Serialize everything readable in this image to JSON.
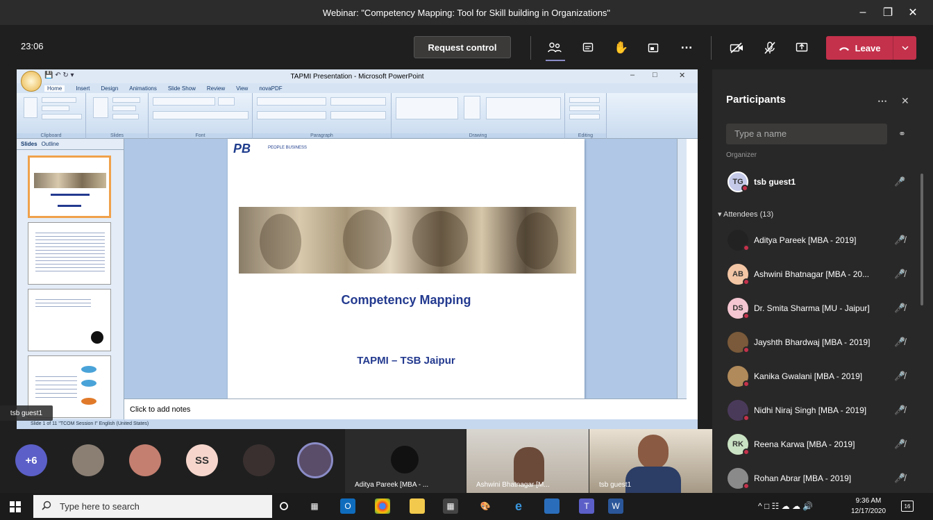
{
  "window": {
    "title": "Webinar: \"Competency Mapping: Tool for Skill building in Organizations\""
  },
  "meeting": {
    "timer": "23:06",
    "request_control": "Request control",
    "leave": "Leave",
    "accent": "#c4314b"
  },
  "shared": {
    "app_title": "TAPMI Presentation - Microsoft PowerPoint",
    "ribbon_tabs": [
      "Home",
      "Insert",
      "Design",
      "Animations",
      "Slide Show",
      "Review",
      "View",
      "novaPDF"
    ],
    "groups": [
      "Clipboard",
      "Slides",
      "Font",
      "Paragraph",
      "Drawing",
      "Editing"
    ],
    "pane_tabs": [
      "Slides",
      "Outline"
    ],
    "slide_title": "Competency Mapping",
    "slide_subtitle": "TAPMI – TSB Jaipur",
    "logo_text": "PB",
    "logo_sub": "PEOPLE BUSINESS",
    "notes": "Click to add notes",
    "status": "Slide 1 of 11     \"TCOM Session I\"    English (United States)",
    "presenter_label": "tsb guest1"
  },
  "participants": {
    "title": "Participants",
    "search_placeholder": "Type a name",
    "presenter_section_tail": "Organizer",
    "presenter": {
      "initials": "TG",
      "name": "tsb guest1"
    },
    "attendees_header": "Attendees (13)",
    "attendees": [
      {
        "initials": "",
        "name": "Aditya Pareek [MBA - 2019]",
        "color": "#222222"
      },
      {
        "initials": "AB",
        "name": "Ashwini Bhatnagar [MBA - 20...",
        "color": "#f3c6a5"
      },
      {
        "initials": "DS",
        "name": "Dr. Smita Sharma [MU - Jaipur]",
        "color": "#f4c6d1"
      },
      {
        "initials": "",
        "name": "Jayshth Bhardwaj [MBA - 2019]",
        "color": "#7a5a3a"
      },
      {
        "initials": "",
        "name": "Kanika Gwalani [MBA - 2019]",
        "color": "#b08a5a"
      },
      {
        "initials": "",
        "name": "Nidhi Niraj Singh [MBA - 2019]",
        "color": "#4a3a5a"
      },
      {
        "initials": "RK",
        "name": "Reena Karwa [MBA - 2019]",
        "color": "#c9e2c3"
      },
      {
        "initials": "",
        "name": "Rohan Abrar [MBA - 2019]",
        "color": "#8a8a8a"
      }
    ]
  },
  "video_strip": {
    "overflow": "+6",
    "circles": [
      "",
      "",
      "SS",
      "",
      ""
    ],
    "tiles": [
      {
        "caption": "Aditya Pareek [MBA - ..."
      },
      {
        "caption": "Ashwini Bhatnagar [M..."
      },
      {
        "caption": "tsb guest1"
      }
    ]
  },
  "taskbar": {
    "search_placeholder": "Type here to search",
    "time": "9:36 AM",
    "date": "12/17/2020",
    "notification_count": "16"
  }
}
